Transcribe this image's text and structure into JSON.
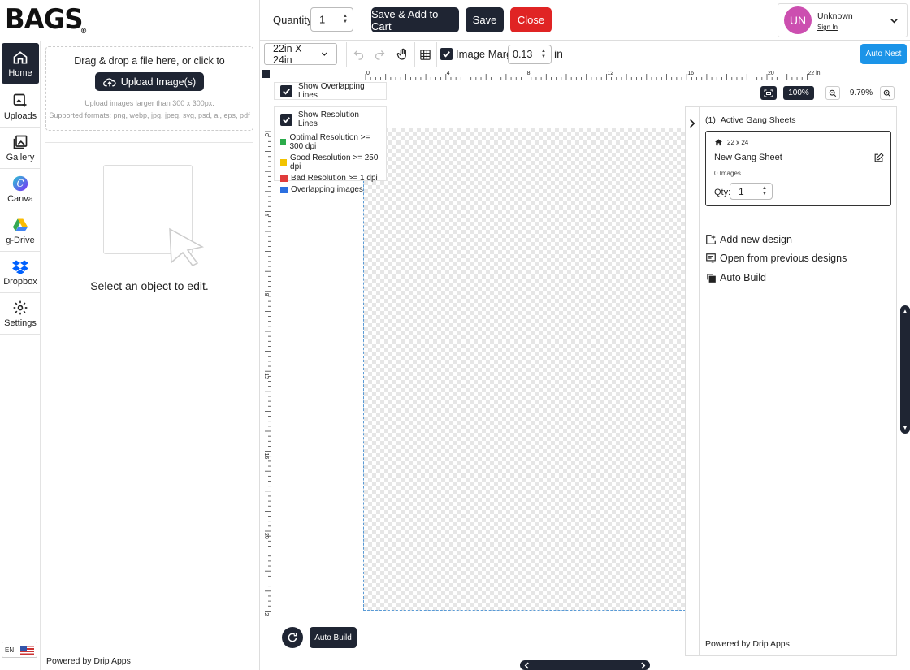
{
  "brand": {
    "logo": "BAGS",
    "logo_mark": "®"
  },
  "nav": [
    {
      "label": "Home",
      "icon": "home-icon"
    },
    {
      "label": "Uploads",
      "icon": "upload-icon"
    },
    {
      "label": "Gallery",
      "icon": "gallery-icon"
    },
    {
      "label": "Canva",
      "icon": "canva-icon"
    },
    {
      "label": "g-Drive",
      "icon": "gdrive-icon"
    },
    {
      "label": "Dropbox",
      "icon": "dropbox-icon"
    },
    {
      "label": "Settings",
      "icon": "gear-icon"
    }
  ],
  "language": "EN",
  "upload": {
    "drop_text": "Drag & drop a file here, or click to",
    "button_label": "Upload Image(s)",
    "hint_size": "Upload images larger than 300 x 300px.",
    "hint_formats": "Supported formats: png, webp, jpg, jpeg, svg, psd, ai, eps, pdf"
  },
  "editor": {
    "select_message": "Select an object to edit."
  },
  "powered": {
    "prefix": "Powered by ",
    "name": "Drip Apps"
  },
  "topbar": {
    "quantity_label": "Quantity:",
    "quantity_value": "1",
    "save_add_label": "Save & Add to Cart",
    "save_label": "Save",
    "close_label": "Close"
  },
  "user": {
    "initials": "UN",
    "name": "Unknown",
    "signin": "Sign In"
  },
  "toolbar": {
    "sheet_size": "22in X 24in",
    "margin_label": "Image Margin",
    "margin_value": "0.13",
    "margin_unit": "in",
    "auto_nest": "Auto Nest"
  },
  "rulers": {
    "horizontal": [
      "0",
      "4",
      "8",
      "12",
      "16",
      "20",
      "22 in"
    ],
    "vertical": [
      "0",
      "4",
      "8",
      "12",
      "16",
      "20",
      "24 in"
    ]
  },
  "overlays": {
    "overlap_label": "Show Overlapping Lines",
    "resolution_label": "Show Resolution Lines",
    "legend": [
      {
        "label": "Optimal Resolution >= 300 dpi",
        "color": "#2bab4a"
      },
      {
        "label": "Good Resolution >= 250 dpi",
        "color": "#f2c300"
      },
      {
        "label": "Bad Resolution >= 1 dpi",
        "color": "#e03b3b"
      },
      {
        "label": "Overlapping images",
        "color": "#2b6fe0"
      }
    ]
  },
  "zoom": {
    "reset": "100%",
    "level": "9.79%"
  },
  "gang": {
    "count_label": "(1)",
    "title": "Active Gang Sheets",
    "card": {
      "size": "22 x 24",
      "name": "New Gang Sheet",
      "images": "0 Images",
      "qty_label": "Qty:",
      "qty_value": "1"
    },
    "actions": [
      "Add new design",
      "Open from previous designs",
      "Auto Build"
    ]
  },
  "bottom": {
    "auto_build": "Auto Build"
  },
  "colors": {
    "dark": "#1f2533",
    "close": "#e02424",
    "accent": "#1b94e8",
    "avatar": "#cc4fb0"
  }
}
